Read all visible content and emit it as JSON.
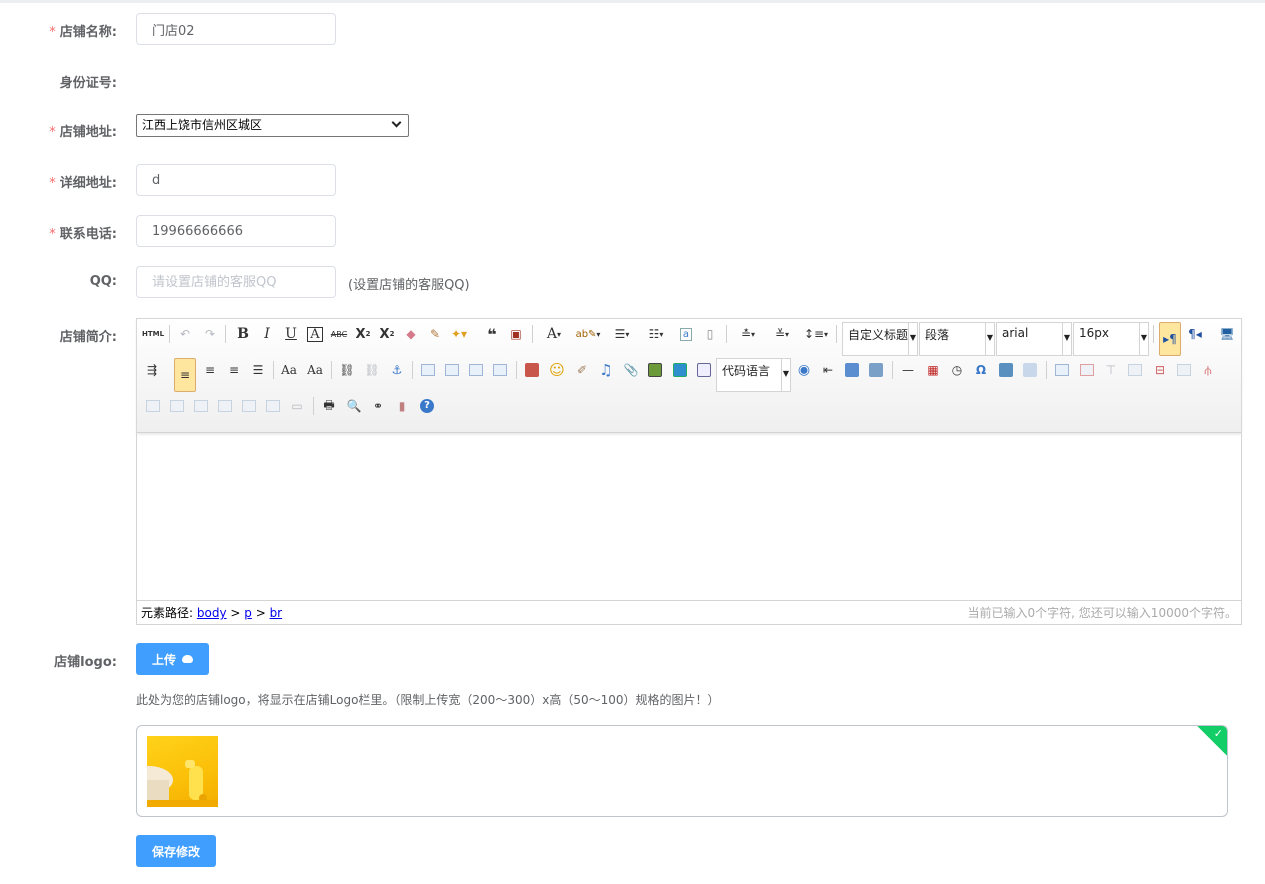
{
  "form": {
    "store_name": {
      "label": "店铺名称:",
      "value": "门店02"
    },
    "id_number": {
      "label": "身份证号:"
    },
    "store_address": {
      "label": "店铺地址:",
      "value": "江西上饶市信州区城区"
    },
    "detail_address": {
      "label": "详细地址:",
      "value": "d"
    },
    "phone": {
      "label": "联系电话:",
      "value": "19966666666"
    },
    "qq": {
      "label": "QQ:",
      "placeholder": "请设置店铺的客服QQ",
      "hint": "(设置店铺的客服QQ)"
    },
    "intro": {
      "label": "店铺简介:"
    },
    "logo": {
      "label": "店铺logo:",
      "upload_label": "上传",
      "note": "此处为您的店铺logo，将显示在店铺Logo栏里。（限制上传宽（200～300）x高（50～100）规格的图片！）"
    },
    "save_label": "保存修改"
  },
  "editor": {
    "html_label": "HTML",
    "custom_heading": "自定义标题",
    "paragraph": "段落",
    "font_family": "arial",
    "font_size": "16px",
    "code_language": "代码语言",
    "path_label": "元素路径:",
    "path": [
      "body",
      "p",
      "br"
    ],
    "word_count": "当前已输入0个字符, 您还可以输入10000个字符。"
  },
  "colors": {
    "primary": "#409eff",
    "required": "#f56c6c",
    "success": "#13ce66"
  }
}
